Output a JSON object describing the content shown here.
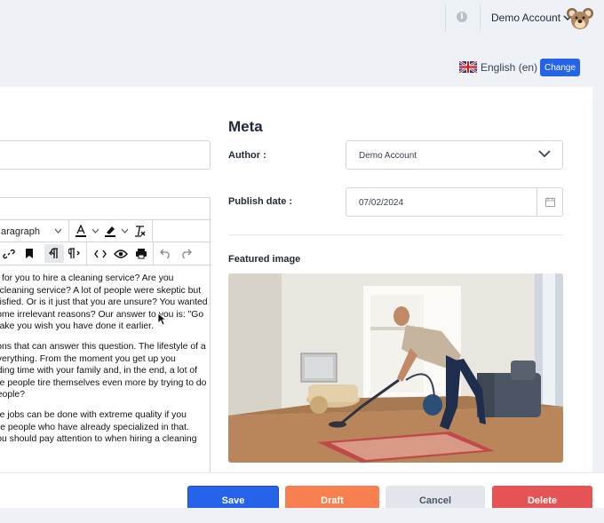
{
  "header": {
    "account_name": "Demo Account",
    "info_icon": "info-icon",
    "avatar_icon": "koala-avatar"
  },
  "language": {
    "label": "English (en)",
    "change_label": "Change",
    "flag_icon": "uk-flag-icon"
  },
  "editor": {
    "paragraph_select": "aragraph",
    "paragraphs": [
      [
        "al for you to hire a cleaning service? Are you",
        "a cleaning service? A lot of people were skeptic but",
        "atisfied. Or is it just that you are unsure? You wanted",
        "some irrelevant reasons? Our answer to you is: \"Go",
        " make you wish you have done it earlier."
      ],
      [
        "sons that can answer this question. The lifestyle of a",
        "everything. From the moment you get up you",
        "nding time with your family and, in the end, a lot of",
        "me people tire themselves even more by trying to do",
        " people?"
      ],
      [
        "me jobs can be done with extreme quality if you",
        "are people who have already specialized in that.",
        "you should pay attention to when hiring a cleaning"
      ]
    ]
  },
  "meta": {
    "title": "Meta",
    "author_label": "Author :",
    "author_value": "Demo Account",
    "publish_date_label": "Publish date :",
    "publish_date_value": "07/02/2024",
    "featured_image_label": "Featured image"
  },
  "actions": {
    "save": "Save",
    "draft": "Draft",
    "cancel": "Cancel",
    "delete": "Delete"
  },
  "colors": {
    "primary": "#2563eb",
    "draft": "#f87f4f",
    "cancel": "#e2e6ec",
    "delete": "#e55454"
  }
}
